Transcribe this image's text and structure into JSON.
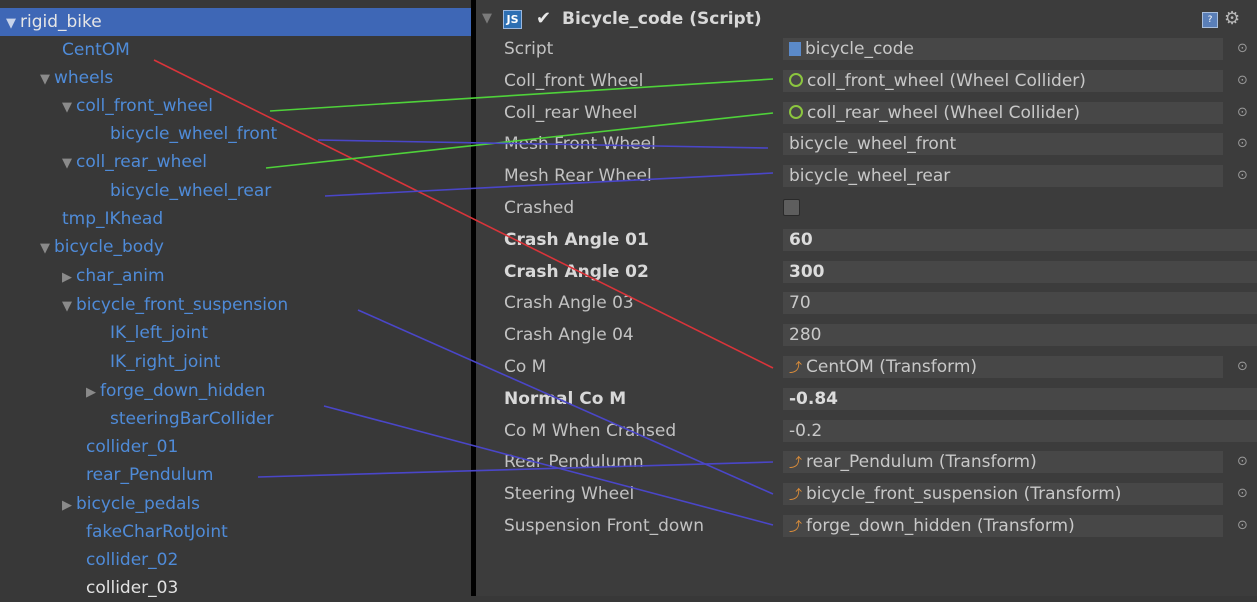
{
  "hierarchy": {
    "items": [
      {
        "label": "rigid_bike",
        "arrow": "▼",
        "selected": true
      },
      {
        "label": "CentOM",
        "arrow": ""
      },
      {
        "label": "wheels",
        "arrow": "▼"
      },
      {
        "label": "coll_front_wheel",
        "arrow": "▼"
      },
      {
        "label": "bicycle_wheel_front",
        "arrow": ""
      },
      {
        "label": "coll_rear_wheel",
        "arrow": "▼"
      },
      {
        "label": "bicycle_wheel_rear",
        "arrow": ""
      },
      {
        "label": "tmp_IKhead",
        "arrow": ""
      },
      {
        "label": "bicycle_body",
        "arrow": "▼"
      },
      {
        "label": "char_anim",
        "arrow": "▶"
      },
      {
        "label": "bicycle_front_suspension",
        "arrow": "▼"
      },
      {
        "label": "IK_left_joint",
        "arrow": ""
      },
      {
        "label": "IK_right_joint",
        "arrow": ""
      },
      {
        "label": "forge_down_hidden",
        "arrow": "▶"
      },
      {
        "label": "steeringBarCollider",
        "arrow": ""
      },
      {
        "label": "collider_01",
        "arrow": ""
      },
      {
        "label": "rear_Pendulum",
        "arrow": ""
      },
      {
        "label": "bicycle_pedals",
        "arrow": "▶"
      },
      {
        "label": "fakeCharRotJoint",
        "arrow": ""
      },
      {
        "label": "collider_02",
        "arrow": ""
      },
      {
        "label": "collider_03",
        "arrow": ""
      }
    ]
  },
  "inspector": {
    "component_title": "Bicycle_code (Script)",
    "js_icon_text": "JS",
    "check_glyph": "✔",
    "help_glyph": "?",
    "gear_glyph": "⚙",
    "picker_glyph": "⊙",
    "fold_glyph": "▼",
    "properties": [
      {
        "label": "Script",
        "value": "bicycle_code",
        "icon": "script",
        "picker": true
      },
      {
        "label": "Coll_front Wheel",
        "value": "coll_front_wheel (Wheel Collider)",
        "icon": "collider",
        "picker": true
      },
      {
        "label": "Coll_rear Wheel",
        "value": "coll_rear_wheel (Wheel Collider)",
        "icon": "collider",
        "picker": true
      },
      {
        "label": "Mesh Front Wheel",
        "value": "bicycle_wheel_front",
        "icon": "",
        "picker": true
      },
      {
        "label": "Mesh Rear Wheel",
        "value": "bicycle_wheel_rear",
        "icon": "",
        "picker": true
      },
      {
        "label": "Crashed",
        "value": "",
        "checkbox": true,
        "checked": false
      },
      {
        "label": "Crash Angle 01",
        "value": "60",
        "bold": true
      },
      {
        "label": "Crash Angle 02",
        "value": "300",
        "bold": true
      },
      {
        "label": "Crash Angle 03",
        "value": "70"
      },
      {
        "label": "Crash Angle 04",
        "value": "280"
      },
      {
        "label": "Co M",
        "value": "CentOM (Transform)",
        "icon": "transform",
        "picker": true
      },
      {
        "label": "Normal Co M",
        "value": "-0.84",
        "bold": true
      },
      {
        "label": "Co M When Crahsed",
        "value": "-0.2"
      },
      {
        "label": "Rear Pendulumn",
        "value": "rear_Pendulum (Transform)",
        "icon": "transform",
        "picker": true
      },
      {
        "label": "Steering Wheel",
        "value": "bicycle_front_suspension (Transform)",
        "icon": "transform",
        "picker": true
      },
      {
        "label": "Suspension Front_down",
        "value": "forge_down_hidden (Transform)",
        "icon": "transform",
        "picker": true
      }
    ]
  },
  "annotations": {
    "colors": {
      "red": "#d9343a",
      "green": "#4fd23a",
      "blue": "#4a46c8"
    },
    "links": [
      {
        "from": "CentOM",
        "to": "Co M",
        "color": "red"
      },
      {
        "from": "coll_front_wheel",
        "to": "Coll_front Wheel",
        "color": "green"
      },
      {
        "from": "coll_rear_wheel",
        "to": "Coll_rear Wheel",
        "color": "green"
      },
      {
        "from": "bicycle_wheel_front",
        "to": "Mesh Front Wheel",
        "color": "blue"
      },
      {
        "from": "bicycle_wheel_rear",
        "to": "Mesh Rear Wheel",
        "color": "blue"
      },
      {
        "from": "rear_Pendulum",
        "to": "Rear Pendulumn",
        "color": "blue"
      },
      {
        "from": "bicycle_front_suspension",
        "to": "Steering Wheel",
        "color": "blue"
      },
      {
        "from": "forge_down_hidden",
        "to": "Suspension Front_down",
        "color": "blue"
      }
    ]
  }
}
